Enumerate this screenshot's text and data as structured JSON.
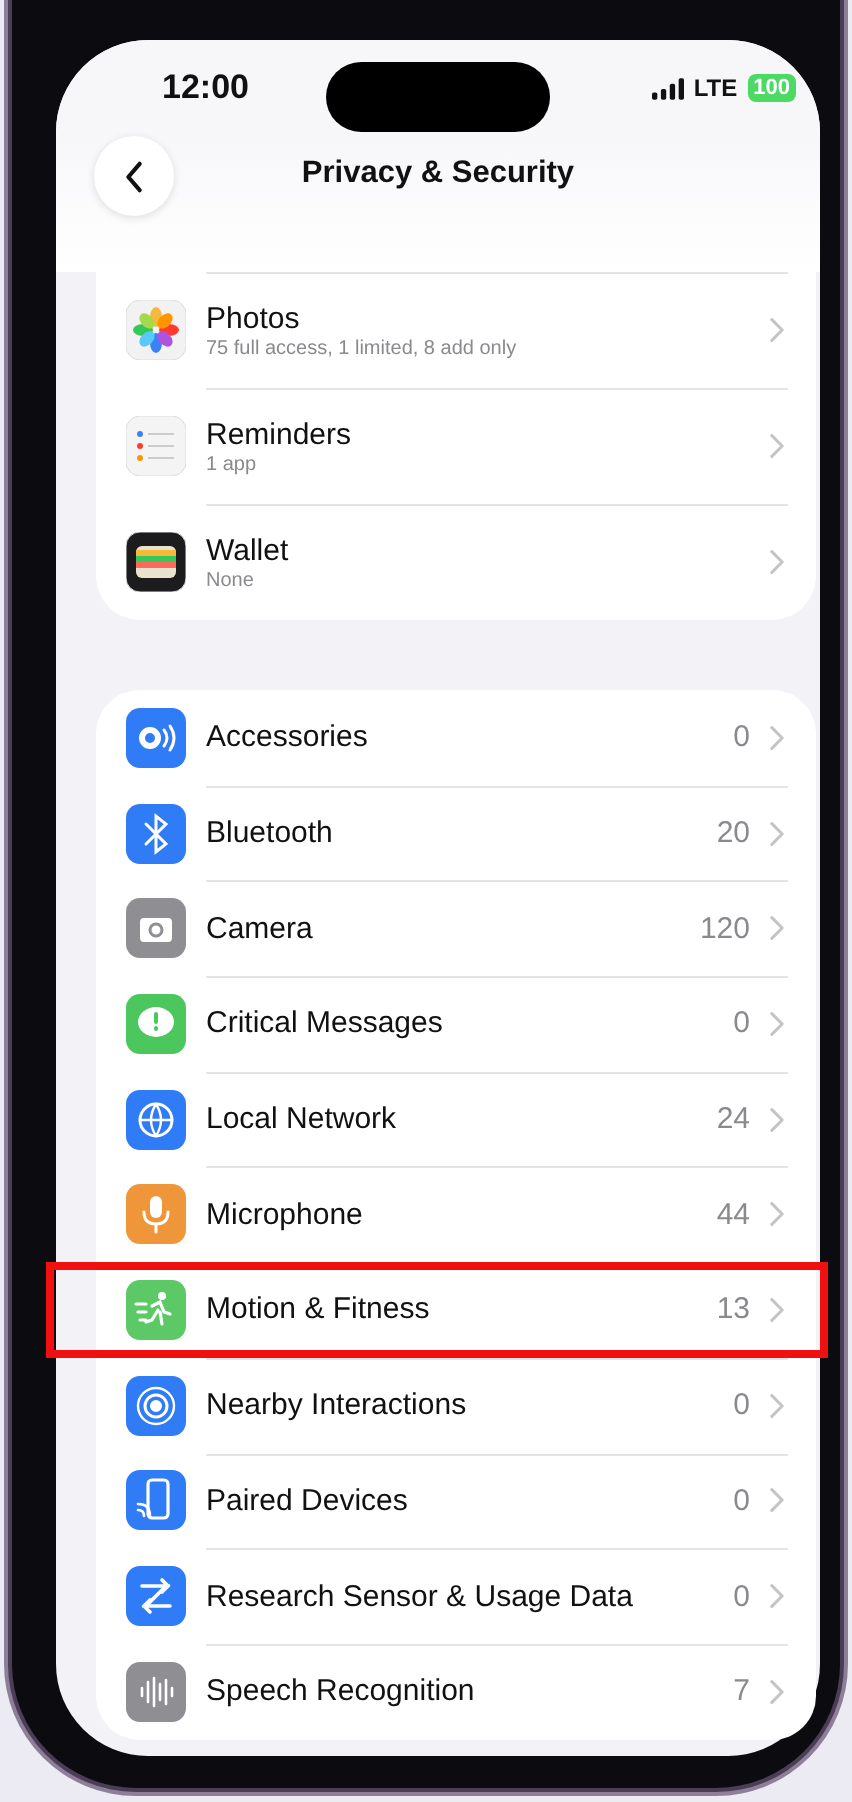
{
  "status_bar": {
    "time": "12:00",
    "network": "LTE",
    "battery": "100"
  },
  "nav": {
    "title": "Privacy & Security"
  },
  "group_1": [
    {
      "title": "Photos",
      "subtitle": "75 full access, 1 limited, 8 add only"
    },
    {
      "title": "Reminders",
      "subtitle": "1 app"
    },
    {
      "title": "Wallet",
      "subtitle": "None"
    }
  ],
  "group_2": [
    {
      "title": "Accessories",
      "count": "0",
      "highlighted": false
    },
    {
      "title": "Bluetooth",
      "count": "20",
      "highlighted": false
    },
    {
      "title": "Camera",
      "count": "120",
      "highlighted": false
    },
    {
      "title": "Critical Messages",
      "count": "0",
      "highlighted": false
    },
    {
      "title": "Local Network",
      "count": "24",
      "highlighted": false
    },
    {
      "title": "Microphone",
      "count": "44",
      "highlighted": false
    },
    {
      "title": "Motion & Fitness",
      "count": "13",
      "highlighted": true
    },
    {
      "title": "Nearby Interactions",
      "count": "0",
      "highlighted": false
    },
    {
      "title": "Paired Devices",
      "count": "0",
      "highlighted": false
    },
    {
      "title": "Research Sensor & Usage Data",
      "count": "0",
      "highlighted": false
    },
    {
      "title": "Speech Recognition",
      "count": "7",
      "highlighted": false
    }
  ]
}
